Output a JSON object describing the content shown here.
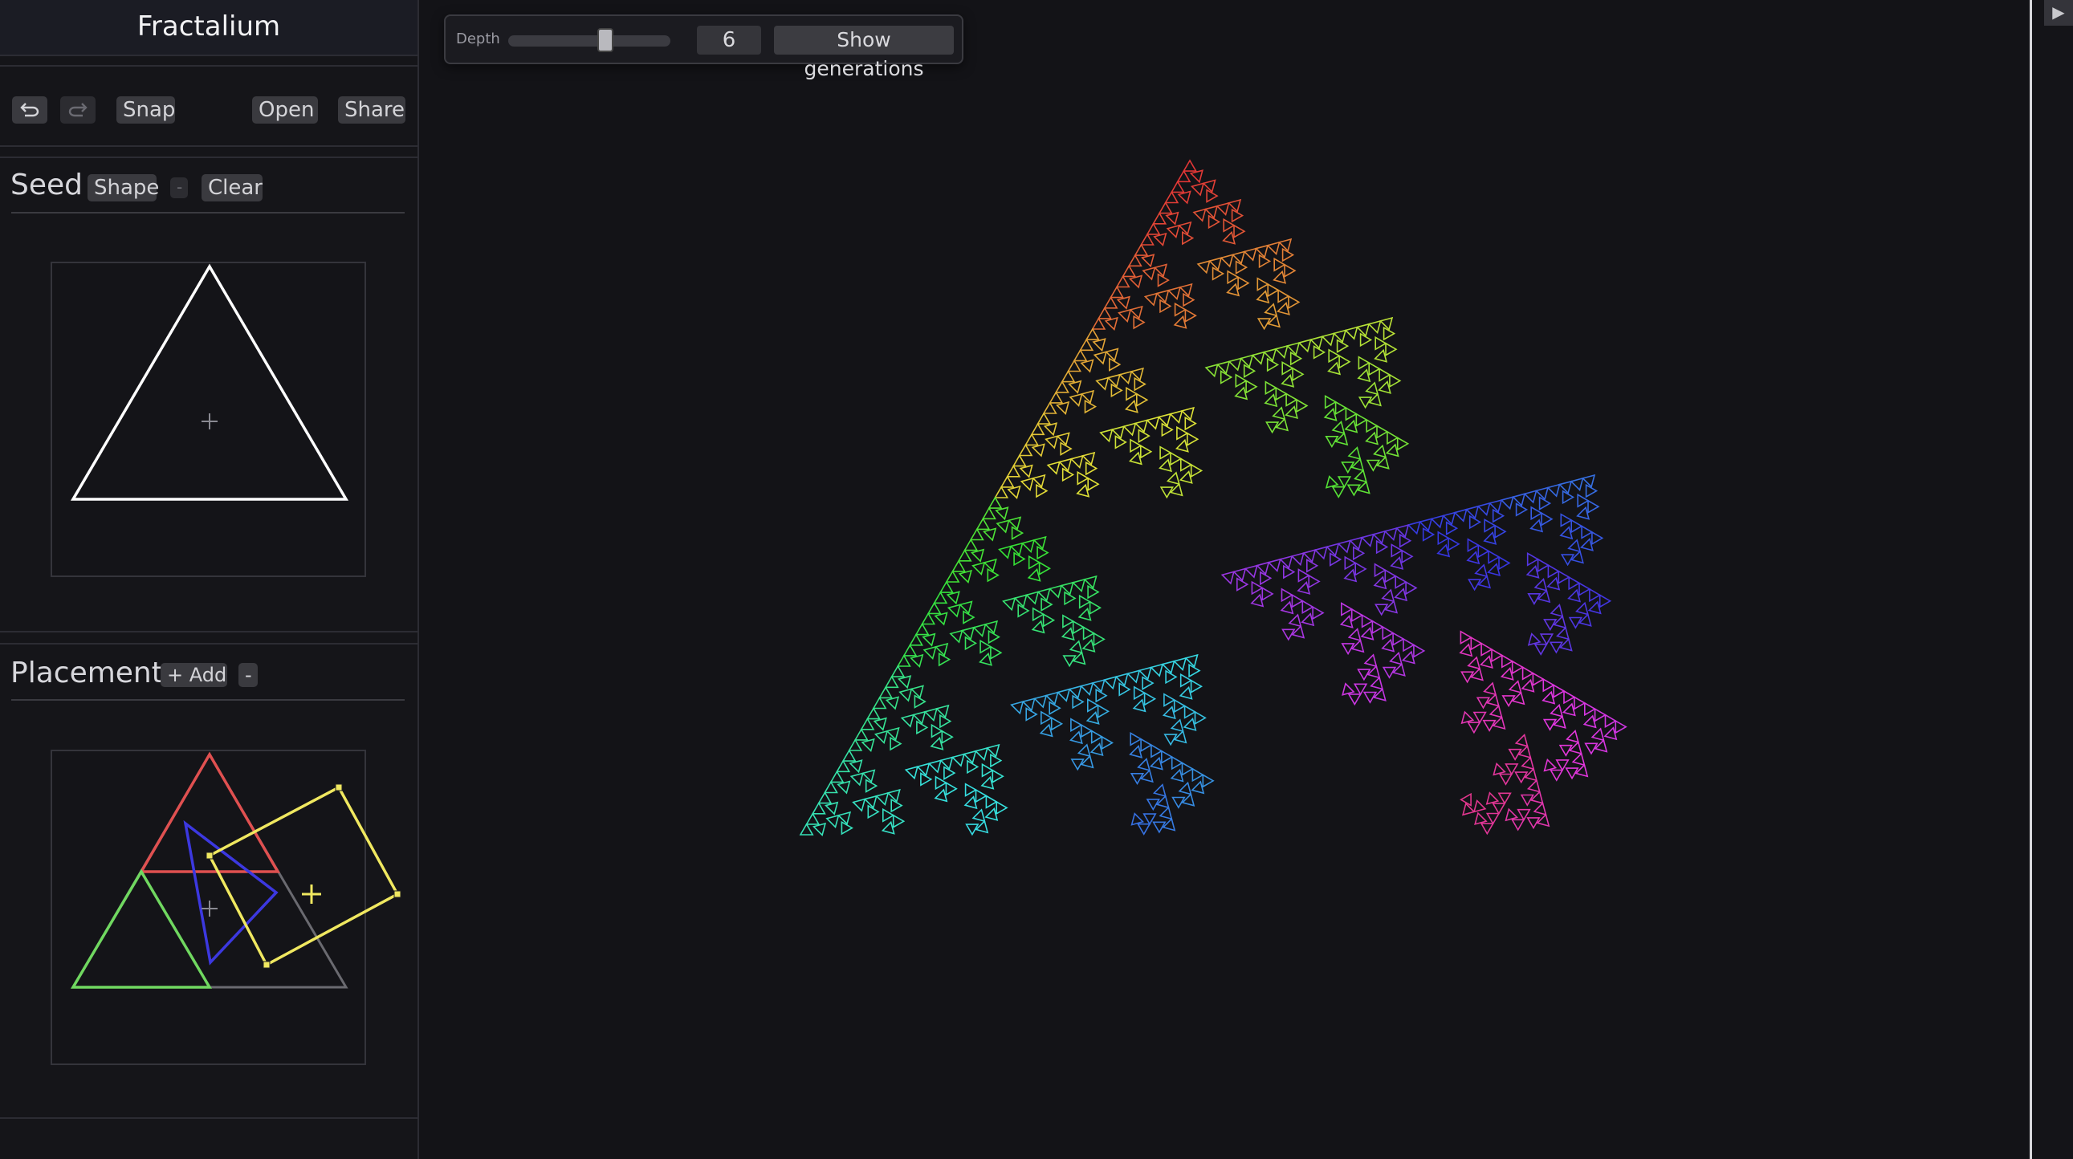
{
  "app": {
    "title": "Fractalium"
  },
  "toolbar": {
    "undo_icon": "undo-icon",
    "redo_icon": "redo-icon",
    "snap_label": "Snap",
    "open_label": "Open",
    "share_label": "Share"
  },
  "seed": {
    "title": "Seed",
    "shape_label": "Shape",
    "minus_label": "-",
    "clear_label": "Clear"
  },
  "placement": {
    "title": "Placement",
    "add_label": "+ Add",
    "minus_label": "-"
  },
  "controls": {
    "depth_label": "Depth",
    "depth_value": "6",
    "depth_fraction": 0.6,
    "show_generations_label": "Show generations"
  },
  "colors": {
    "background": "#131317",
    "placement_red": "#e05050",
    "placement_green": "#70d860",
    "placement_blue": "#3c38e0",
    "placement_yellow": "#f0e860",
    "seed_stroke": "#ffffff"
  },
  "collapse": {
    "icon": "play-icon",
    "glyph": "▶"
  }
}
